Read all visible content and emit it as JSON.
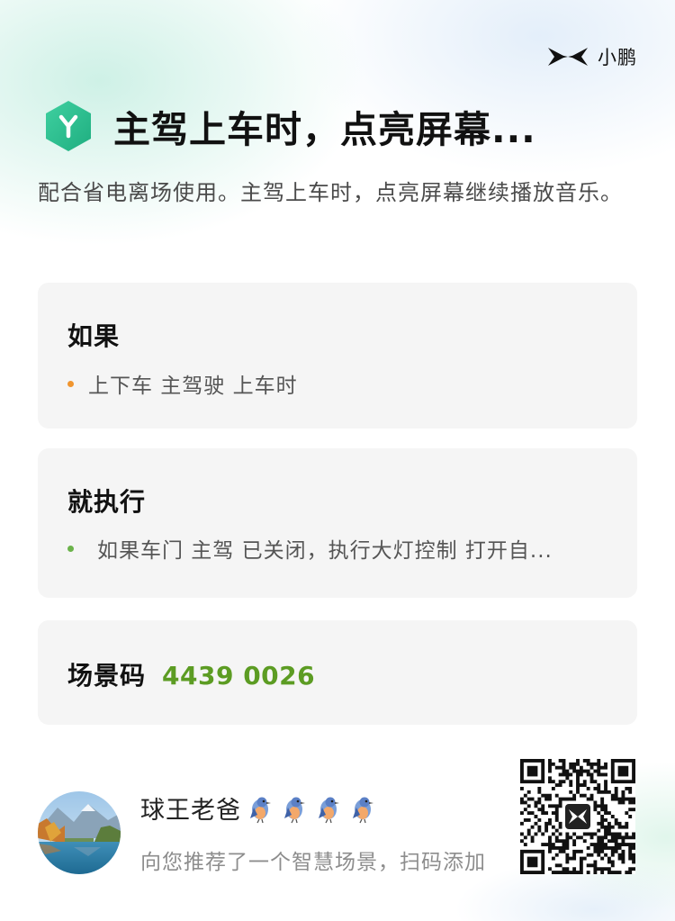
{
  "brand": {
    "name": "小鹏",
    "logo_icon": "xpeng-x-logo-icon"
  },
  "header": {
    "title": "主驾上车时，点亮屏幕...",
    "icon": "scene-y-hexagon-icon",
    "icon_color": "#2dbf8f"
  },
  "description": "配合省电离场使用。主驾上车时，点亮屏幕继续播放音乐。",
  "if_card": {
    "title": "如果",
    "condition": "上下车 主驾驶 上车时",
    "bullet_color": "#f0952e"
  },
  "then_card": {
    "title": "就执行",
    "action": "如果车门 主驾 已关闭，执行大灯控制 打开自...",
    "bullet_color": "#6bb34a"
  },
  "code_card": {
    "label": "场景码",
    "code": "4439 0026",
    "code_color": "#5c9c23"
  },
  "user": {
    "name": "球王老爸",
    "emoji": [
      "🐦",
      "🐦",
      "🐦",
      "🐦"
    ],
    "subtitle": "向您推荐了一个智慧场景，扫码添加",
    "avatar": "landscape-avatar"
  },
  "qr": {
    "icon": "qr-code-icon",
    "center_logo": "xpeng-x-logo-icon"
  }
}
